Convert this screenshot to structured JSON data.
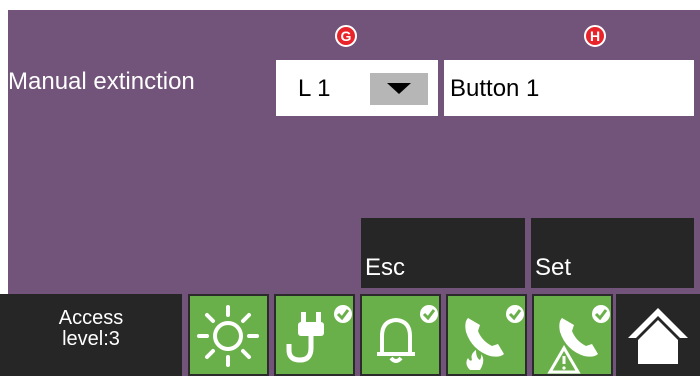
{
  "markers": {
    "g": "G",
    "h": "H"
  },
  "form": {
    "label": "Manual extinction",
    "select_value": "L 1",
    "text_value": "Button 1"
  },
  "buttons": {
    "esc": "Esc",
    "set": "Set"
  },
  "status_bar": {
    "access_line1": "Access",
    "access_line2": "level:3",
    "tiles": [
      "sun-icon",
      "power-plug-icon",
      "bell-icon",
      "phone-fire-icon",
      "phone-warning-icon"
    ],
    "home": "home-icon"
  },
  "colors": {
    "background": "#72547a",
    "button": "#262626",
    "tile_green": "#6ab04a",
    "marker_red": "#e8232a"
  }
}
